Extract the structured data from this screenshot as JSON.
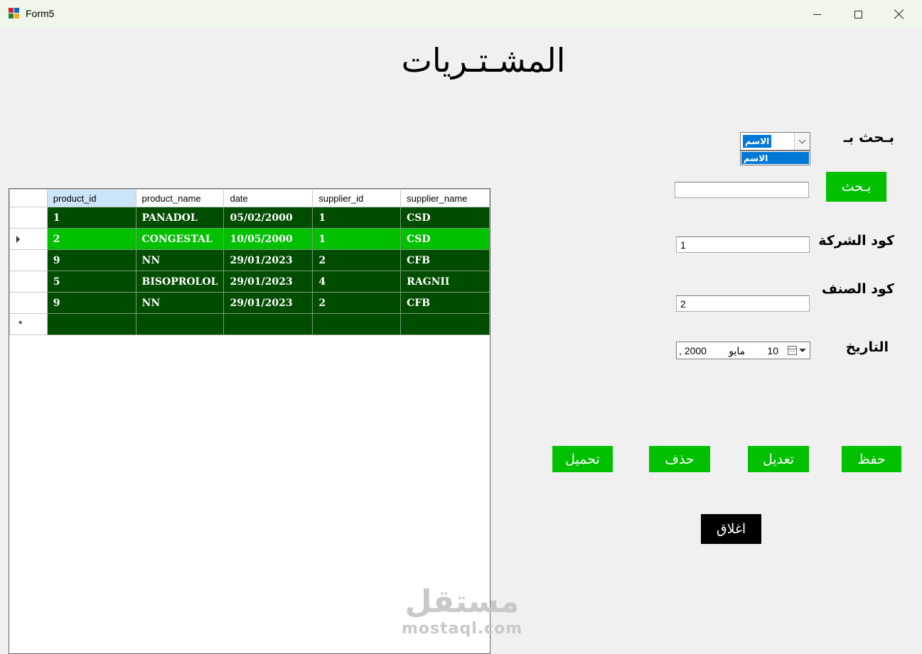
{
  "window": {
    "title": "Form5"
  },
  "page": {
    "title": "المشـتـريات"
  },
  "search": {
    "label": "بـحث بـ",
    "combo_value": "الاسم",
    "dropdown_options": [
      "الاسم"
    ],
    "input_value": "",
    "button_label": "بـحث"
  },
  "form": {
    "supplier_code_label": "كود الشركة",
    "supplier_code_value": "1",
    "item_code_label": "كود الصنف",
    "item_code_value": "2",
    "date_label": "التاريخ",
    "date_day": "10",
    "date_month": "مايو",
    "date_year": ", 2000"
  },
  "actions": {
    "save": "حفظ",
    "edit": "تعديل",
    "delete": "حذف",
    "load": "تحميل",
    "close": "اغلاق"
  },
  "grid": {
    "columns": [
      "product_id",
      "product_name",
      "date",
      "supplier_id",
      "supplier_name"
    ],
    "rows": [
      [
        "1",
        "PANADOL",
        "05/02/2000",
        "1",
        "CSD"
      ],
      [
        "2",
        "CONGESTAL",
        "10/05/2000",
        "1",
        "CSD"
      ],
      [
        "9",
        "NN",
        "29/01/2023",
        "2",
        "CFB"
      ],
      [
        "5",
        "BISOPROLOL",
        "29/01/2023",
        "4",
        "RAGNII"
      ],
      [
        "9",
        "NN",
        "29/01/2023",
        "2",
        "CFB"
      ]
    ],
    "new_row_marker": "*"
  },
  "watermark": {
    "arabic": "مستقل",
    "latin": "mostaql.com"
  },
  "colors": {
    "row_dark": "#004d00",
    "row_selected": "#00c000",
    "button_green": "#00c000",
    "close_button": "#000000",
    "header_selected": "#cce4f7"
  }
}
